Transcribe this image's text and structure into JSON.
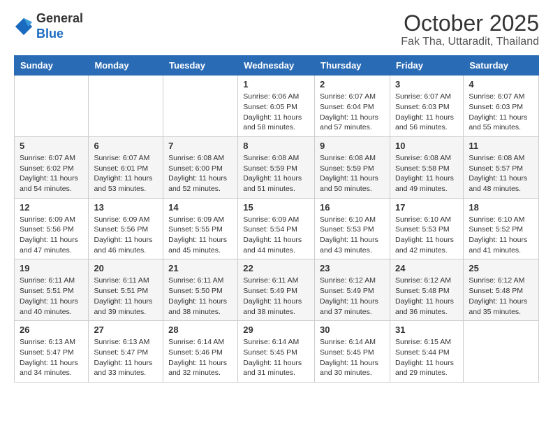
{
  "header": {
    "logo_general": "General",
    "logo_blue": "Blue",
    "month_title": "October 2025",
    "location": "Fak Tha, Uttaradit, Thailand"
  },
  "weekdays": [
    "Sunday",
    "Monday",
    "Tuesday",
    "Wednesday",
    "Thursday",
    "Friday",
    "Saturday"
  ],
  "weeks": [
    {
      "shaded": false,
      "days": [
        {
          "num": "",
          "info": ""
        },
        {
          "num": "",
          "info": ""
        },
        {
          "num": "",
          "info": ""
        },
        {
          "num": "1",
          "info": "Sunrise: 6:06 AM\nSunset: 6:05 PM\nDaylight: 11 hours\nand 58 minutes."
        },
        {
          "num": "2",
          "info": "Sunrise: 6:07 AM\nSunset: 6:04 PM\nDaylight: 11 hours\nand 57 minutes."
        },
        {
          "num": "3",
          "info": "Sunrise: 6:07 AM\nSunset: 6:03 PM\nDaylight: 11 hours\nand 56 minutes."
        },
        {
          "num": "4",
          "info": "Sunrise: 6:07 AM\nSunset: 6:03 PM\nDaylight: 11 hours\nand 55 minutes."
        }
      ]
    },
    {
      "shaded": true,
      "days": [
        {
          "num": "5",
          "info": "Sunrise: 6:07 AM\nSunset: 6:02 PM\nDaylight: 11 hours\nand 54 minutes."
        },
        {
          "num": "6",
          "info": "Sunrise: 6:07 AM\nSunset: 6:01 PM\nDaylight: 11 hours\nand 53 minutes."
        },
        {
          "num": "7",
          "info": "Sunrise: 6:08 AM\nSunset: 6:00 PM\nDaylight: 11 hours\nand 52 minutes."
        },
        {
          "num": "8",
          "info": "Sunrise: 6:08 AM\nSunset: 5:59 PM\nDaylight: 11 hours\nand 51 minutes."
        },
        {
          "num": "9",
          "info": "Sunrise: 6:08 AM\nSunset: 5:59 PM\nDaylight: 11 hours\nand 50 minutes."
        },
        {
          "num": "10",
          "info": "Sunrise: 6:08 AM\nSunset: 5:58 PM\nDaylight: 11 hours\nand 49 minutes."
        },
        {
          "num": "11",
          "info": "Sunrise: 6:08 AM\nSunset: 5:57 PM\nDaylight: 11 hours\nand 48 minutes."
        }
      ]
    },
    {
      "shaded": false,
      "days": [
        {
          "num": "12",
          "info": "Sunrise: 6:09 AM\nSunset: 5:56 PM\nDaylight: 11 hours\nand 47 minutes."
        },
        {
          "num": "13",
          "info": "Sunrise: 6:09 AM\nSunset: 5:56 PM\nDaylight: 11 hours\nand 46 minutes."
        },
        {
          "num": "14",
          "info": "Sunrise: 6:09 AM\nSunset: 5:55 PM\nDaylight: 11 hours\nand 45 minutes."
        },
        {
          "num": "15",
          "info": "Sunrise: 6:09 AM\nSunset: 5:54 PM\nDaylight: 11 hours\nand 44 minutes."
        },
        {
          "num": "16",
          "info": "Sunrise: 6:10 AM\nSunset: 5:53 PM\nDaylight: 11 hours\nand 43 minutes."
        },
        {
          "num": "17",
          "info": "Sunrise: 6:10 AM\nSunset: 5:53 PM\nDaylight: 11 hours\nand 42 minutes."
        },
        {
          "num": "18",
          "info": "Sunrise: 6:10 AM\nSunset: 5:52 PM\nDaylight: 11 hours\nand 41 minutes."
        }
      ]
    },
    {
      "shaded": true,
      "days": [
        {
          "num": "19",
          "info": "Sunrise: 6:11 AM\nSunset: 5:51 PM\nDaylight: 11 hours\nand 40 minutes."
        },
        {
          "num": "20",
          "info": "Sunrise: 6:11 AM\nSunset: 5:51 PM\nDaylight: 11 hours\nand 39 minutes."
        },
        {
          "num": "21",
          "info": "Sunrise: 6:11 AM\nSunset: 5:50 PM\nDaylight: 11 hours\nand 38 minutes."
        },
        {
          "num": "22",
          "info": "Sunrise: 6:11 AM\nSunset: 5:49 PM\nDaylight: 11 hours\nand 38 minutes."
        },
        {
          "num": "23",
          "info": "Sunrise: 6:12 AM\nSunset: 5:49 PM\nDaylight: 11 hours\nand 37 minutes."
        },
        {
          "num": "24",
          "info": "Sunrise: 6:12 AM\nSunset: 5:48 PM\nDaylight: 11 hours\nand 36 minutes."
        },
        {
          "num": "25",
          "info": "Sunrise: 6:12 AM\nSunset: 5:48 PM\nDaylight: 11 hours\nand 35 minutes."
        }
      ]
    },
    {
      "shaded": false,
      "days": [
        {
          "num": "26",
          "info": "Sunrise: 6:13 AM\nSunset: 5:47 PM\nDaylight: 11 hours\nand 34 minutes."
        },
        {
          "num": "27",
          "info": "Sunrise: 6:13 AM\nSunset: 5:47 PM\nDaylight: 11 hours\nand 33 minutes."
        },
        {
          "num": "28",
          "info": "Sunrise: 6:14 AM\nSunset: 5:46 PM\nDaylight: 11 hours\nand 32 minutes."
        },
        {
          "num": "29",
          "info": "Sunrise: 6:14 AM\nSunset: 5:45 PM\nDaylight: 11 hours\nand 31 minutes."
        },
        {
          "num": "30",
          "info": "Sunrise: 6:14 AM\nSunset: 5:45 PM\nDaylight: 11 hours\nand 30 minutes."
        },
        {
          "num": "31",
          "info": "Sunrise: 6:15 AM\nSunset: 5:44 PM\nDaylight: 11 hours\nand 29 minutes."
        },
        {
          "num": "",
          "info": ""
        }
      ]
    }
  ]
}
